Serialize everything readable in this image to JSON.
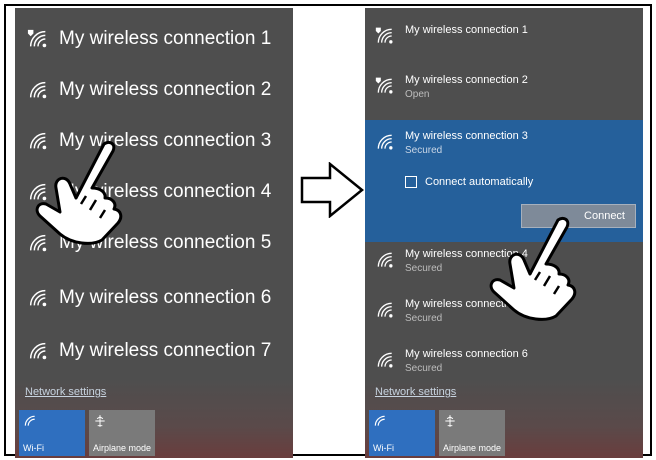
{
  "left_panel": {
    "networks": [
      {
        "name": "My wireless connection 1",
        "secured_icon": true
      },
      {
        "name": "My wireless connection 2"
      },
      {
        "name": "My wireless connection 3"
      },
      {
        "name": "My wireless connection 4"
      },
      {
        "name": "My wireless connection 5"
      },
      {
        "name": "My wireless connection 6"
      },
      {
        "name": "My wireless connection 7"
      }
    ],
    "network_settings": "Network settings",
    "tiles": {
      "wifi": "Wi-Fi",
      "airplane": "Airplane mode"
    }
  },
  "right_panel": {
    "networks": [
      {
        "name": "My wireless connection 1",
        "status": ""
      },
      {
        "name": "My wireless connection 2",
        "status": "Open"
      },
      {
        "name": "My wireless connection 3",
        "status": "Secured"
      },
      {
        "name": "My wireless connection 4",
        "status": "Secured"
      },
      {
        "name": "My wireless connection 5",
        "status": "Secured"
      },
      {
        "name": "My wireless connection 6",
        "status": "Secured"
      }
    ],
    "connect_automatically": "Connect automatically",
    "connect_button": "Connect",
    "network_settings": "Network settings",
    "tiles": {
      "wifi": "Wi-Fi",
      "airplane": "Airplane mode"
    }
  },
  "colors": {
    "panel": "#4e4e4e",
    "selected": "#25609b",
    "wifi_tile": "#2f6fbf"
  },
  "icons": [
    "wifi-icon",
    "wifi-secured-icon",
    "airplane-icon",
    "hand-pointer-icon",
    "right-arrow-icon"
  ]
}
